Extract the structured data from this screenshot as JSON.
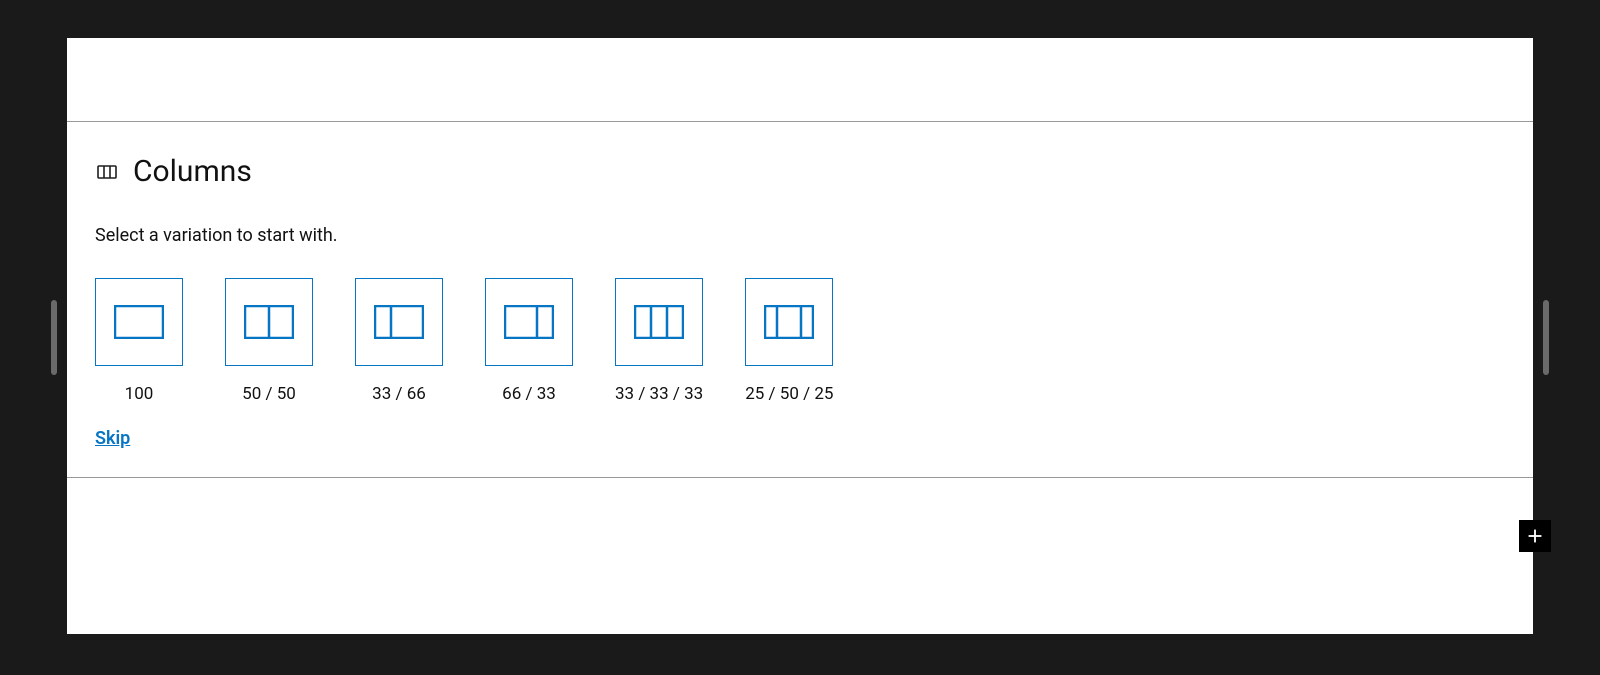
{
  "block": {
    "title": "Columns",
    "instruction": "Select a variation to start with.",
    "skip_label": "Skip"
  },
  "variations": [
    {
      "label": "100"
    },
    {
      "label": "50 / 50"
    },
    {
      "label": "33 / 66"
    },
    {
      "label": "66 / 33"
    },
    {
      "label": "33 / 33 / 33"
    },
    {
      "label": "25 / 50 / 25"
    }
  ]
}
